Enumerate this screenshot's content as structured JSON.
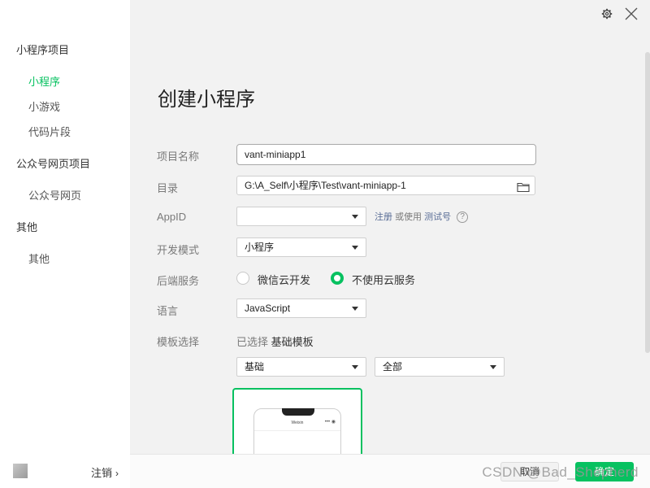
{
  "sidebar": {
    "groups": [
      {
        "label": "小程序项目",
        "items": [
          {
            "label": "小程序"
          },
          {
            "label": "小游戏"
          },
          {
            "label": "代码片段"
          }
        ]
      },
      {
        "label": "公众号网页项目",
        "items": [
          {
            "label": "公众号网页"
          }
        ]
      },
      {
        "label": "其他",
        "items": [
          {
            "label": "其他"
          }
        ]
      }
    ],
    "active_item": "小程序",
    "logout_label": "注销"
  },
  "header": {
    "settings_icon": "gear-icon",
    "close_icon": "close-icon"
  },
  "form": {
    "title": "创建小程序",
    "project_name": {
      "label": "项目名称",
      "value": "vant-miniapp1"
    },
    "directory": {
      "label": "目录",
      "value": "G:\\A_Self\\小程序\\Test\\vant-miniapp-1",
      "icon": "folder-icon"
    },
    "appid": {
      "label": "AppID",
      "value": "",
      "register_link": "注册",
      "or_use": "或使用",
      "test_link": "测试号",
      "help": "?"
    },
    "dev_mode": {
      "label": "开发模式",
      "value": "小程序"
    },
    "backend": {
      "label": "后端服务",
      "options": [
        "微信云开发",
        "不使用云服务"
      ],
      "selected": "不使用云服务"
    },
    "language": {
      "label": "语言",
      "value": "JavaScript"
    },
    "template": {
      "label": "模板选择",
      "selected_prefix": "已选择",
      "selected_name": "基础模板",
      "category": "基础",
      "filter": "全部",
      "preview_title": "Weixin",
      "preview_capsule": "••• ◉"
    }
  },
  "footer": {
    "cancel_label": "取消",
    "ok_label": "确定"
  },
  "watermark": "CSDN @Bad_Shepherd",
  "colors": {
    "accent": "#07c160",
    "link": "#576b95",
    "sidebar_bg": "#ffffff",
    "main_bg": "#f2f2f2"
  }
}
